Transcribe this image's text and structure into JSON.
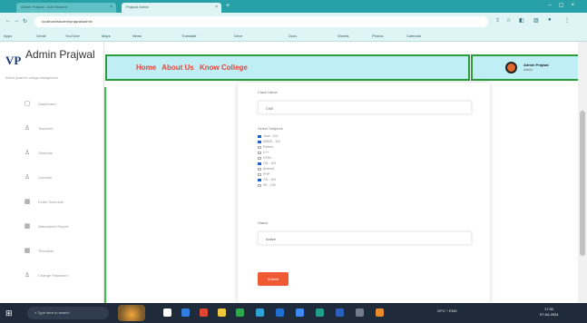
{
  "browser": {
    "tabs": [
      {
        "label": "Admin Prajwal - Add Student",
        "active": false
      },
      {
        "label": "Prajwal Admin",
        "active": true
      }
    ],
    "url": "localhost/student/prajwal/admin",
    "bookmarks": [
      "Apps",
      "Gmail",
      "YouTube",
      "Maps",
      "News",
      "Translate",
      "Drive",
      "Docs",
      "Sheets",
      "Photos",
      "Calendar"
    ]
  },
  "sidebar": {
    "brand_logo": "VP",
    "brand_name": "Admin Prajwal",
    "brand_tagline": "Admin panel for college management",
    "items": [
      {
        "icon": "dashboard-icon",
        "glyph": "▢",
        "label": "Dashboard"
      },
      {
        "icon": "user-icon",
        "glyph": "♙",
        "label": "Teachers"
      },
      {
        "icon": "user-icon",
        "glyph": "♙",
        "label": "Students"
      },
      {
        "icon": "user-icon",
        "glyph": "♙",
        "label": "Courses"
      },
      {
        "icon": "calendar-icon",
        "glyph": "▦",
        "label": "Exam Schedule"
      },
      {
        "icon": "calendar-icon",
        "glyph": "▦",
        "label": "Attendance Report"
      },
      {
        "icon": "calendar-icon",
        "glyph": "▦",
        "label": "Timetable"
      },
      {
        "icon": "user-icon",
        "glyph": "♙",
        "label": "Change Password"
      }
    ]
  },
  "topnav": {
    "links": [
      "Home",
      "About Us",
      "Know College"
    ]
  },
  "user": {
    "name": "Admin Prajwal",
    "role": "Admin"
  },
  "form": {
    "class_name_label": "Class Name",
    "class_name_value": "CSE",
    "subjects_label": "Select Subjects",
    "subjects": [
      {
        "label": "Java - 101",
        "checked": true
      },
      {
        "label": "DBMS - 102",
        "checked": true
      },
      {
        "label": "Python",
        "checked": false
      },
      {
        "label": "C++",
        "checked": false
      },
      {
        "label": "HTML",
        "checked": false
      },
      {
        "label": "CN - 103",
        "checked": true
      },
      {
        "label": "Android",
        "checked": false
      },
      {
        "label": "PHP",
        "checked": false
      },
      {
        "label": "OS - 104",
        "checked": true
      },
      {
        "label": "SE - 105",
        "checked": false
      }
    ],
    "status_label": "Status",
    "status_value": "Active",
    "submit_label": "Submit"
  },
  "taskbar": {
    "search_placeholder": "Type here to search",
    "tray_text": "29°C  ^  ENG",
    "time": "17:02",
    "date": "07-04-2024"
  },
  "colors": {
    "topnav_bg": "#bfeef4",
    "topnav_border": "#2a9d39",
    "nav_link": "#e8443a",
    "submit_bg": "#ef5a35",
    "browser_tab": "#27a0a7"
  }
}
